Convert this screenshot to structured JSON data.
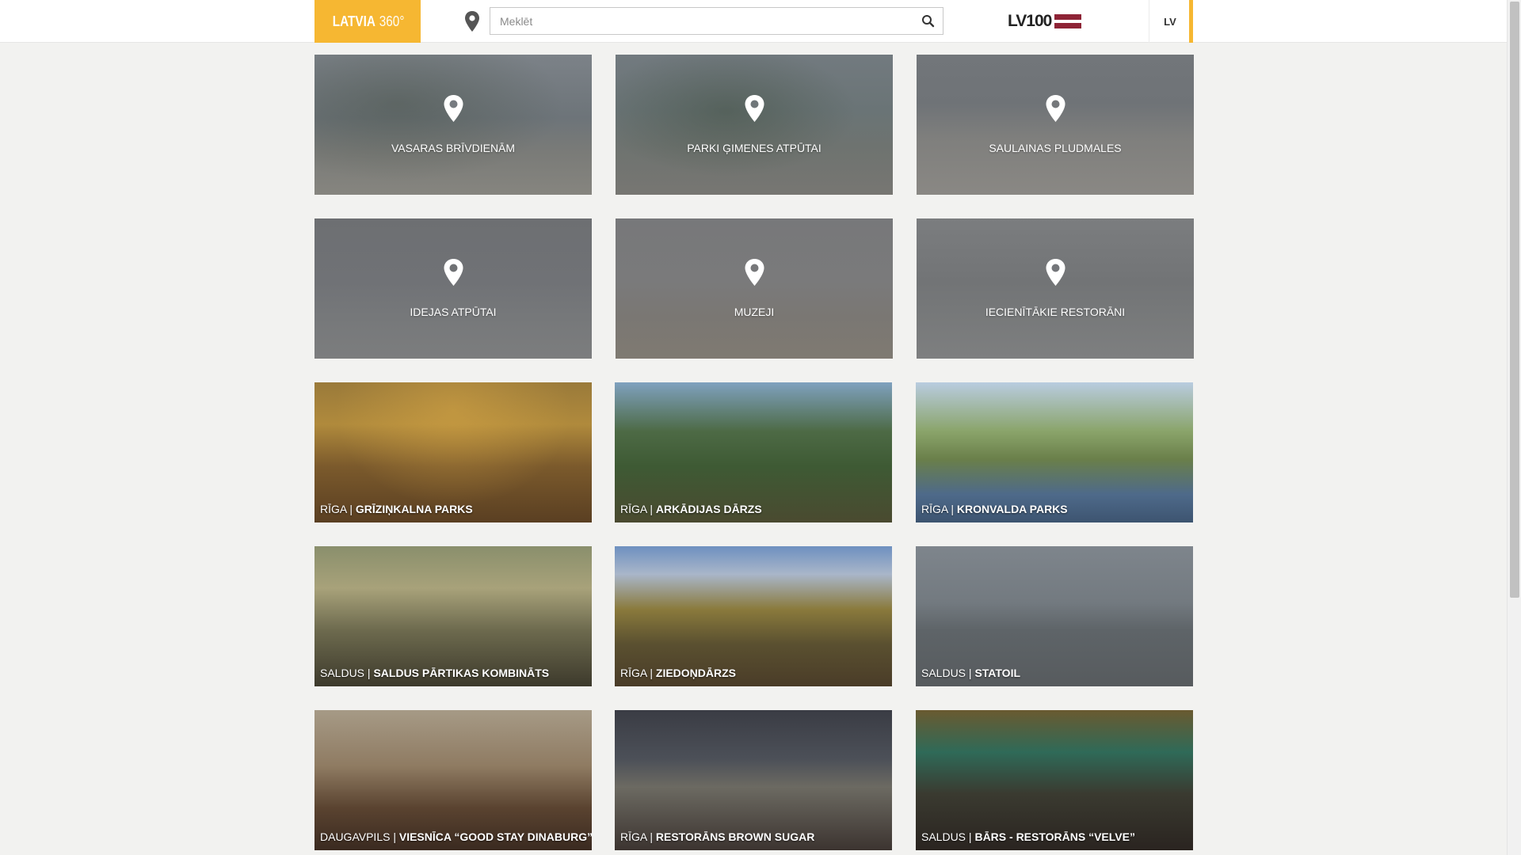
{
  "header": {
    "logo_bold": "LATVIA",
    "logo_light": "360°",
    "search_placeholder": "Meklēt",
    "lv100_text": "LV100",
    "language": "LV",
    "accent_color": "#f6b732"
  },
  "categories": [
    {
      "label": "VASARAS BRĪVDIENĀM",
      "icon": "map-pin-icon"
    },
    {
      "label": "PARKI ĢIMENES ATPŪTAI",
      "icon": "map-pin-icon"
    },
    {
      "label": "SAULAINAS PLUDMALES",
      "icon": "map-pin-icon"
    },
    {
      "label": "IDEJAS ATPŪTAI",
      "icon": "map-pin-icon"
    },
    {
      "label": "MUZEJI",
      "icon": "map-pin-icon"
    },
    {
      "label": "IECIENĪTĀKIE RESTORĀNI",
      "icon": "map-pin-icon"
    }
  ],
  "places": [
    {
      "city": "RĪGA",
      "name": "GRĪZIŅKALNA PARKS"
    },
    {
      "city": "RĪGA",
      "name": "ARKĀDIJAS DĀRZS"
    },
    {
      "city": "RĪGA",
      "name": "KRONVALDA PARKS"
    },
    {
      "city": "SALDUS",
      "name": "SALDUS PĀRTIKAS KOMBINĀTS"
    },
    {
      "city": "RĪGA",
      "name": "ZIEDOŅDĀRZS"
    },
    {
      "city": "SALDUS",
      "name": "STATOIL"
    },
    {
      "city": "DAUGAVPILS",
      "name": "VIESNĪCA “GOOD STAY DINABURG”"
    },
    {
      "city": "RĪGA",
      "name": "RESTORĀNS BROWN SUGAR"
    },
    {
      "city": "SALDUS",
      "name": "BĀRS - RESTORĀNS “VELVE”"
    }
  ],
  "separator": "|"
}
